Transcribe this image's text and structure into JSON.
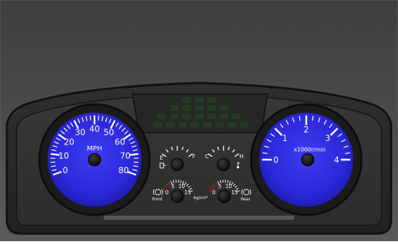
{
  "speedometer": {
    "unit": "MPH",
    "labels": [
      "0",
      "10",
      "20",
      "30",
      "40",
      "50",
      "60",
      "70",
      "80"
    ],
    "dial_color": "#2d2ae0"
  },
  "tachometer": {
    "unit": "x1000r/min",
    "labels": [
      "0",
      "1",
      "2",
      "3",
      "4"
    ],
    "dial_color": "#2d2ae0"
  },
  "fuel_gauge": {
    "empty_label": "E",
    "full_label": "F",
    "icon": "fuel-pump-icon"
  },
  "temp_gauge": {
    "cold_label": "C",
    "hot_label": "H",
    "icon": "thermometer-icon"
  },
  "front_pressure": {
    "labels": [
      "0",
      "5",
      "10",
      "15"
    ],
    "side_label": "Front",
    "icon": "brake-warning-icon"
  },
  "rear_pressure": {
    "labels": [
      "0",
      "5",
      "10",
      "15"
    ],
    "side_label": "Rear",
    "icon": "brake-warning-icon"
  },
  "pressure_unit": "kg/cm²",
  "colors": {
    "dial": "#2d2ae0",
    "panel": "#3a3a3a",
    "bezel": "#1a1a1a",
    "grid": "#243a24",
    "redline": "#d61f1f"
  }
}
